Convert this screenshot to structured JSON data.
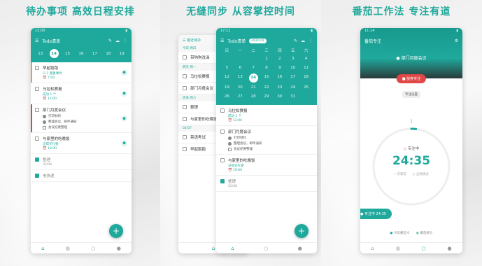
{
  "panel1": {
    "heading": "待办事项 高效日程安排",
    "status_time": "12:00",
    "app_title": "Todo清单",
    "dates": [
      "13",
      "14",
      "15",
      "16",
      "17",
      "18",
      "19"
    ],
    "selected_date_index": 1,
    "tasks": [
      {
        "title": "早起跑跑",
        "sub": "☑ 2 重复事件",
        "time": "7:00",
        "stripe": "#f0a020",
        "done": false
      },
      {
        "title": "马拉松赛报",
        "sub": "成功 1 个",
        "time": "12:00",
        "stripe": "",
        "done": false
      },
      {
        "title": "部门月度会议",
        "stripe": "#e04848",
        "done": false,
        "subitems": [
          {
            "text": "打印材料",
            "done": true
          },
          {
            "text": "整理会议，邮件通知",
            "done": true
          },
          {
            "text": "会议纪要整理",
            "done": false
          }
        ]
      },
      {
        "title": "与家里的吃晚饭",
        "sub": "记得买礼物",
        "time": "19:00",
        "stripe": "",
        "done": false
      },
      {
        "title": "整理",
        "sub": "02/08",
        "stripe": "",
        "done": true
      },
      {
        "title": "电快递",
        "sub": "",
        "stripe": "",
        "done": true
      }
    ],
    "fab_label": "+",
    "nav_icons": [
      "home",
      "drop",
      "circle",
      "person"
    ]
  },
  "panel2": {
    "heading": "无缝同步 从容掌控时间",
    "back_title": "最近待办",
    "back_sections": [
      "今日·周日",
      "明天·周一",
      "周末·周六",
      "02/07"
    ],
    "back_tasks": [
      "带狗狗洗澡",
      "马拉松赛报",
      "部门月度会议",
      "整理",
      "与家里的吃晚饭",
      "英语考试",
      "早起跑跑"
    ],
    "status_time": "17:11",
    "app_title": "Todo清单",
    "month_badge": "2020.01",
    "weekdays": [
      "日",
      "一",
      "二",
      "三",
      "四",
      "五",
      "六"
    ],
    "calendar": [
      "",
      "",
      "",
      "1",
      "2",
      "3",
      "4",
      "5",
      "6",
      "7",
      "8",
      "9",
      "10",
      "11",
      "12",
      "13",
      "14",
      "15",
      "16",
      "17",
      "18",
      "19",
      "20",
      "21",
      "22",
      "23",
      "24",
      "25",
      "26",
      "27",
      "28",
      "29",
      "30",
      "31",
      ""
    ],
    "selected_day": "14",
    "tasks": [
      {
        "title": "马拉松赛报",
        "sub": "成功 1 个",
        "time": "12:00",
        "done": false
      },
      {
        "title": "部门月度会议",
        "done": false,
        "subitems": [
          {
            "text": "打印材料",
            "done": true
          },
          {
            "text": "整理会议，邮件通知",
            "done": true
          },
          {
            "text": "会议纪要整理",
            "done": false
          }
        ]
      },
      {
        "title": "与家里的吃晚饭",
        "sub": "记得买礼物",
        "time": "19:00",
        "done": false
      },
      {
        "title": "整理",
        "sub": "02/08",
        "done": true
      }
    ],
    "fab_label": "+"
  },
  "panel3": {
    "heading": "番茄工作法 专注有道",
    "status_time": "11:14",
    "app_title": "番茄专注",
    "focus_task": "部门月度会议",
    "quit_button": "放弃专注",
    "tag_label": "专注设置",
    "state_label": "专注中",
    "timer": "24:35",
    "pause_button": "‖",
    "option1": "白噪音",
    "option2": "全屏模式",
    "floating_label": "专注中 24:35",
    "stat1": "今日番茄 0",
    "stat2": "番茄统计",
    "progress_fraction": 0.02
  }
}
